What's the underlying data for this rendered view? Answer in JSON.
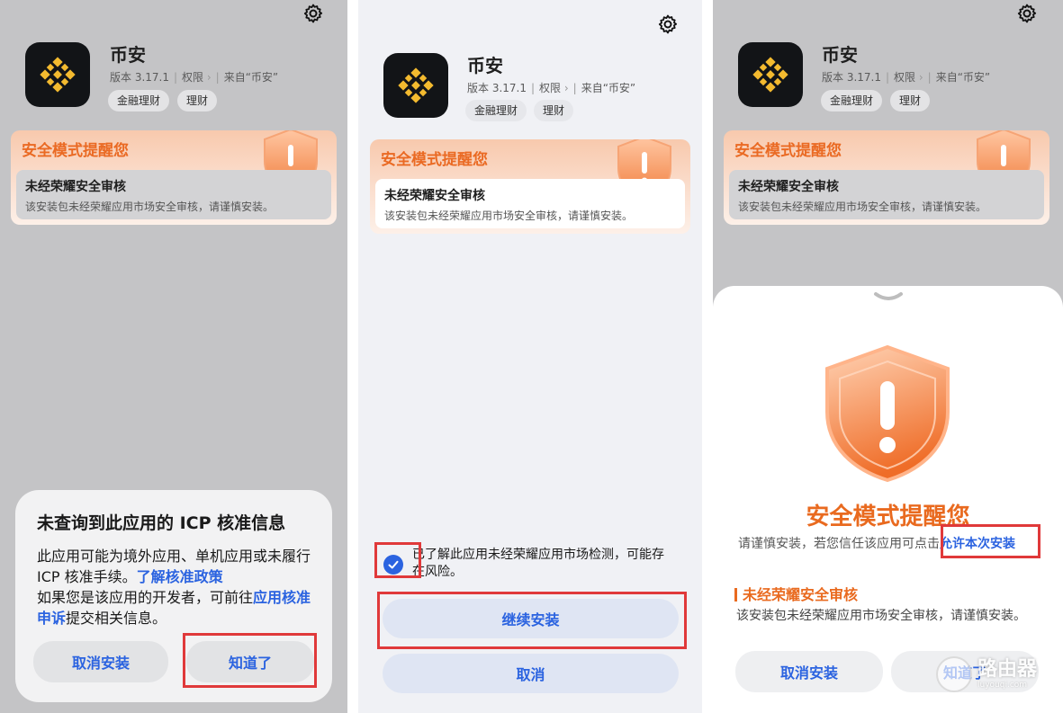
{
  "app": {
    "name": "币安",
    "version": "版本 3.17.1",
    "permissions": "权限",
    "source": "来自“币安”",
    "tags": [
      "金融理财",
      "理财"
    ]
  },
  "warning": {
    "title": "安全模式提醒您",
    "subtitle": "未经荣耀安全审核",
    "desc": "该安装包未经荣耀应用市场安全审核，请谨慎安装。"
  },
  "panel1": {
    "dialog_title": "未查询到此应用的 ICP 核准信息",
    "body_1": "此应用可能为境外应用、单机应用或未履行 ICP 核准手续。",
    "link_policy": "了解核准政策",
    "body_2": "如果您是该应用的开发者，可前往",
    "link_appeal": "应用核准申诉",
    "body_3": "提交相关信息。",
    "cancel_label": "取消安装",
    "ok_label": "知道了"
  },
  "panel2": {
    "checkbox_label": "已了解此应用未经荣耀应用市场检测，可能存在风险。",
    "continue_label": "继续安装",
    "cancel_label": "取消"
  },
  "panel3": {
    "title": "安全模式提醒您",
    "desc": "请谨慎安装，若您信任该应用可点击",
    "allow_link": "允许本次安装",
    "section_title": "未经荣耀安全审核",
    "section_desc": "该安装包未经荣耀应用市场安全审核，请谨慎安装。",
    "cancel_label": "取消安装",
    "ok_label": "知道了"
  },
  "watermark": {
    "text": "路由器",
    "sub": "luyouqi.com"
  },
  "colors": {
    "accent_blue": "#2b63e0",
    "warning_orange": "#e96a1f",
    "highlight_red": "#e0393a"
  }
}
